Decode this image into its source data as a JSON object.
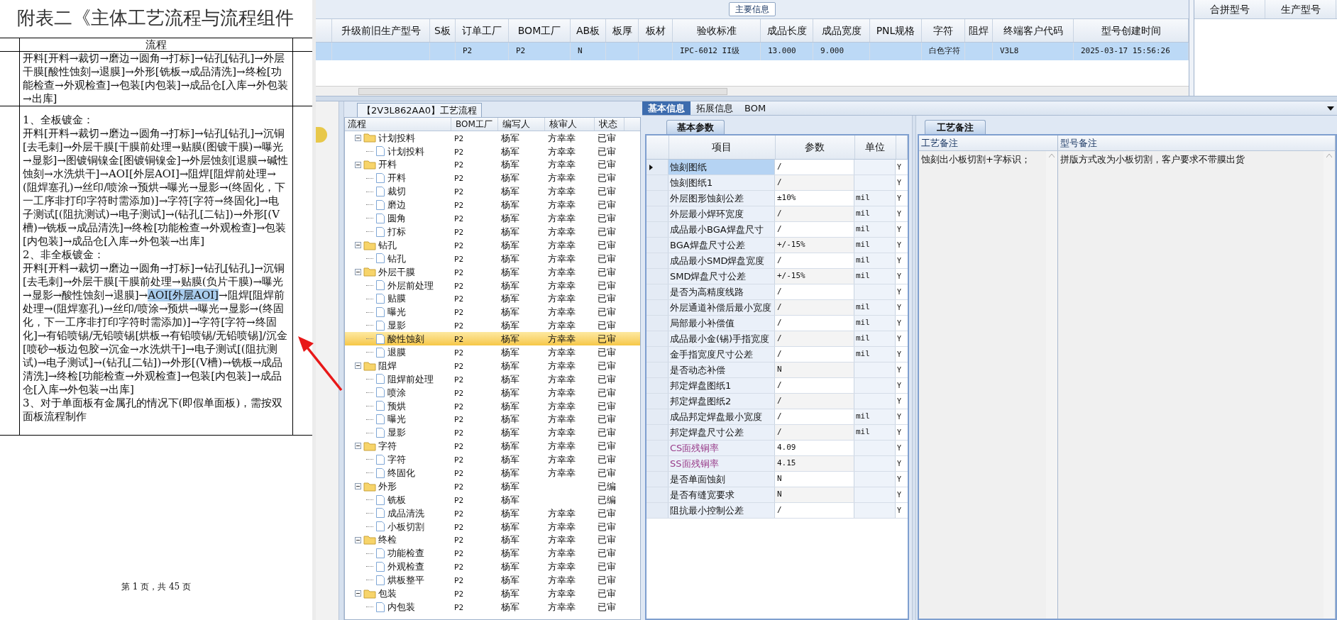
{
  "document": {
    "title": "附表二《主体工艺流程与流程组件",
    "header": "流程",
    "rows": [
      {
        "paragraphs": [
          {
            "text": "开料[开料→裁切→磨边→圆角→打标]→钻孔[钻孔]→外层干膜[酸性蚀刻→退膜]→外形[铣板→成品清洗]→终检[功能检查→外观检查]→包装[内包装]→成品仓[入库→外包装→出库]"
          }
        ]
      },
      {
        "paragraphs": [
          {
            "text": "1、全板镀金："
          },
          {
            "text": "开料[开料→裁切→磨边→圆角→打标]→钻孔[钻孔]→沉铜[去毛刺]→外层干膜[干膜前处理→贴膜(图镀干膜)→曝光→显影]→图镀铜镍金[图镀铜镍金]→外层蚀刻[退膜→碱性蚀刻→水洗烘干]→AOI[外层AOI]→阻焊[阻焊前处理→(阻焊塞孔)→丝印/喷涂→预烘→曝光→显影→(终固化，下一工序非打印字符时需添加)]→字符[字符→终固化]→电子测试[(阻抗测试)→电子测试]→(钻孔[二钻])→外形[(V槽)→铣板→成品清洗]→终检[功能检查→外观检查]→包装[内包装]→成品仓[入库→外包装→出库]"
          },
          {
            "text": "2、非全板镀金："
          },
          {
            "segments": [
              {
                "text": "开料[开料→裁切→磨边→圆角→打标]→钻孔[钻孔]→沉铜[去毛刺]→外层干膜[干膜前处理→贴膜(负片干膜)→曝光→显影→酸性蚀刻→退膜]→",
                "selected": false
              },
              {
                "text": "AOI[外层AOI]",
                "selected": true
              },
              {
                "text": "→阻焊[阻焊前处理→(阻焊塞孔)→丝印/喷涂→预烘→曝光→显影→(终固化，下一工序非打印字符时需添加)]→字符[字符→终固化]→有铅喷锡/无铅喷锡[烘板→有铅喷锡/无铅喷锡]/沉金[喷砂→板边包胶→沉金→水洗烘干]→电子测试[(阻抗测试)→电子测试]→(钻孔[二钻])→外形[(V槽)→铣板→成品清洗]→终检[功能检查→外观检查]→包装[内包装]→成品仓[入库→外包装→出库]",
                "selected": false
              }
            ]
          },
          {
            "text": "3、对于单面板有金属孔的情况下(即假单面板)，需按双面板流程制作"
          }
        ]
      }
    ],
    "footer": "第 1 页，共 45 页"
  },
  "main_info": {
    "title": "主要信息",
    "columns": [
      "升级前旧生产型号",
      "S板",
      "订单工厂",
      "BOM工厂",
      "AB板",
      "板厚",
      "板材",
      "验收标准",
      "成品长度",
      "成品宽度",
      "PNL规格",
      "字符",
      "阻焊",
      "终端客户代码",
      "型号创建时间"
    ],
    "rows": [
      {
        "selected": true,
        "cells": [
          null,
          null,
          "P2",
          "P2",
          "N",
          null,
          null,
          "IPC-6012 II级",
          "13.000",
          "9.000",
          null,
          "白色字符",
          null,
          "V3L8",
          "2025-03-17 15:56:26"
        ]
      }
    ]
  },
  "merge_panel": {
    "columns": [
      "合拼型号",
      "生产型号"
    ]
  },
  "process_panel": {
    "title": "【2V3L862AA0】工艺流程",
    "columns": [
      "流程",
      "BOM工厂",
      "编写人",
      "核审人",
      "状态"
    ],
    "steps": [
      {
        "name": "计划投料",
        "bom": "P2",
        "author": "杨军",
        "reviewer": "方幸幸",
        "status": "已审",
        "expanded": true,
        "selected": false,
        "children": [
          {
            "name": "计划投料",
            "bom": "P2",
            "author": "杨军",
            "reviewer": "方幸幸",
            "status": "已审",
            "selected": false
          }
        ]
      },
      {
        "name": "开料",
        "bom": "P2",
        "author": "杨军",
        "reviewer": "方幸幸",
        "status": "已审",
        "expanded": true,
        "selected": false,
        "children": [
          {
            "name": "开料",
            "bom": "P2",
            "author": "杨军",
            "reviewer": "方幸幸",
            "status": "已审",
            "selected": false
          },
          {
            "name": "裁切",
            "bom": "P2",
            "author": "杨军",
            "reviewer": "方幸幸",
            "status": "已审",
            "selected": false
          },
          {
            "name": "磨边",
            "bom": "P2",
            "author": "杨军",
            "reviewer": "方幸幸",
            "status": "已审",
            "selected": false
          },
          {
            "name": "圆角",
            "bom": "P2",
            "author": "杨军",
            "reviewer": "方幸幸",
            "status": "已审",
            "selected": false
          },
          {
            "name": "打标",
            "bom": "P2",
            "author": "杨军",
            "reviewer": "方幸幸",
            "status": "已审",
            "selected": false
          }
        ]
      },
      {
        "name": "钻孔",
        "bom": "P2",
        "author": "杨军",
        "reviewer": "方幸幸",
        "status": "已审",
        "expanded": true,
        "selected": false,
        "children": [
          {
            "name": "钻孔",
            "bom": "P2",
            "author": "杨军",
            "reviewer": "方幸幸",
            "status": "已审",
            "selected": false
          }
        ]
      },
      {
        "name": "外层干膜",
        "bom": "P2",
        "author": "杨军",
        "reviewer": "方幸幸",
        "status": "已审",
        "expanded": true,
        "selected": false,
        "children": [
          {
            "name": "外层前处理",
            "bom": "P2",
            "author": "杨军",
            "reviewer": "方幸幸",
            "status": "已审",
            "selected": false
          },
          {
            "name": "贴膜",
            "bom": "P2",
            "author": "杨军",
            "reviewer": "方幸幸",
            "status": "已审",
            "selected": false
          },
          {
            "name": "曝光",
            "bom": "P2",
            "author": "杨军",
            "reviewer": "方幸幸",
            "status": "已审",
            "selected": false
          },
          {
            "name": "显影",
            "bom": "P2",
            "author": "杨军",
            "reviewer": "方幸幸",
            "status": "已审",
            "selected": false
          },
          {
            "name": "酸性蚀刻",
            "bom": "P2",
            "author": "杨军",
            "reviewer": "方幸幸",
            "status": "已审",
            "selected": true
          },
          {
            "name": "退膜",
            "bom": "P2",
            "author": "杨军",
            "reviewer": "方幸幸",
            "status": "已审",
            "selected": false
          }
        ]
      },
      {
        "name": "阻焊",
        "bom": "P2",
        "author": "杨军",
        "reviewer": "方幸幸",
        "status": "已审",
        "expanded": true,
        "selected": false,
        "children": [
          {
            "name": "阻焊前处理",
            "bom": "P2",
            "author": "杨军",
            "reviewer": "方幸幸",
            "status": "已审",
            "selected": false
          },
          {
            "name": "喷涂",
            "bom": "P2",
            "author": "杨军",
            "reviewer": "方幸幸",
            "status": "已审",
            "selected": false
          },
          {
            "name": "预烘",
            "bom": "P2",
            "author": "杨军",
            "reviewer": "方幸幸",
            "status": "已审",
            "selected": false
          },
          {
            "name": "曝光",
            "bom": "P2",
            "author": "杨军",
            "reviewer": "方幸幸",
            "status": "已审",
            "selected": false
          },
          {
            "name": "显影",
            "bom": "P2",
            "author": "杨军",
            "reviewer": "方幸幸",
            "status": "已审",
            "selected": false
          }
        ]
      },
      {
        "name": "字符",
        "bom": "P2",
        "author": "杨军",
        "reviewer": "方幸幸",
        "status": "已审",
        "expanded": true,
        "selected": false,
        "children": [
          {
            "name": "字符",
            "bom": "P2",
            "author": "杨军",
            "reviewer": "方幸幸",
            "status": "已审",
            "selected": false
          },
          {
            "name": "终固化",
            "bom": "P2",
            "author": "杨军",
            "reviewer": "方幸幸",
            "status": "已审",
            "selected": false
          }
        ]
      },
      {
        "name": "外形",
        "bom": "P2",
        "author": "杨军",
        "status": "已编",
        "expanded": true,
        "selected": false,
        "children": [
          {
            "name": "铣板",
            "bom": "P2",
            "author": "杨军",
            "status": "已编",
            "selected": false
          },
          {
            "name": "成品清洗",
            "bom": "P2",
            "author": "杨军",
            "reviewer": "方幸幸",
            "status": "已审",
            "selected": false
          },
          {
            "name": "小板切割",
            "bom": "P2",
            "author": "杨军",
            "reviewer": "方幸幸",
            "status": "已审",
            "selected": false
          }
        ]
      },
      {
        "name": "终检",
        "bom": "P2",
        "author": "杨军",
        "reviewer": "方幸幸",
        "status": "已审",
        "expanded": true,
        "selected": false,
        "children": [
          {
            "name": "功能检查",
            "bom": "P2",
            "author": "杨军",
            "reviewer": "方幸幸",
            "status": "已审",
            "selected": false
          },
          {
            "name": "外观检查",
            "bom": "P2",
            "author": "杨军",
            "reviewer": "方幸幸",
            "status": "已审",
            "selected": false
          },
          {
            "name": "烘板整平",
            "bom": "P2",
            "author": "杨军",
            "reviewer": "方幸幸",
            "status": "已审",
            "selected": false
          }
        ]
      },
      {
        "name": "包装",
        "bom": "P2",
        "author": "杨军",
        "reviewer": "方幸幸",
        "status": "已审",
        "expanded": true,
        "selected": false,
        "children": [
          {
            "name": "内包装",
            "bom": "P2",
            "author": "杨军",
            "reviewer": "方幸幸",
            "status": "已审",
            "selected": false
          }
        ]
      }
    ]
  },
  "detail_tabs": [
    {
      "label": "基本信息",
      "selected": true
    },
    {
      "label": "拓展信息",
      "selected": false
    },
    {
      "label": "BOM",
      "selected": false
    }
  ],
  "params_panel": {
    "tab": "基本参数",
    "columns": [
      "项目",
      "参数",
      "单位"
    ],
    "rows": [
      {
        "item": "蚀刻图纸",
        "value": "/",
        "flag": "Y",
        "selected": true
      },
      {
        "item": "蚀刻图纸1",
        "value": "/",
        "flag": "Y",
        "selected": false
      },
      {
        "item": "外层图形蚀刻公差",
        "value": "±10%",
        "unit": "mil",
        "flag": "Y",
        "selected": false
      },
      {
        "item": "外层最小焊环宽度",
        "value": "/",
        "unit": "mil",
        "flag": "Y",
        "selected": false
      },
      {
        "item": "成品最小BGA焊盘尺寸",
        "value": "/",
        "unit": "mil",
        "flag": "Y",
        "selected": false
      },
      {
        "item": "BGA焊盘尺寸公差",
        "value": "+/-15%",
        "unit": "mil",
        "flag": "Y",
        "selected": false
      },
      {
        "item": "成品最小SMD焊盘宽度",
        "value": "/",
        "unit": "mil",
        "flag": "Y",
        "selected": false
      },
      {
        "item": "SMD焊盘尺寸公差",
        "value": "+/-15%",
        "unit": "mil",
        "flag": "Y",
        "selected": false
      },
      {
        "item": "是否为高精度线路",
        "value": "/",
        "flag": "Y",
        "selected": false
      },
      {
        "item": "外层通道补偿后最小宽度",
        "value": "/",
        "unit": "mil",
        "flag": "Y",
        "selected": false
      },
      {
        "item": "局部最小补偿值",
        "value": "/",
        "unit": "mil",
        "flag": "Y",
        "selected": false
      },
      {
        "item": "成品最小金(锡)手指宽度",
        "value": "/",
        "unit": "mil",
        "flag": "Y",
        "selected": false
      },
      {
        "item": "金手指宽度尺寸公差",
        "value": "/",
        "unit": "mil",
        "flag": "Y",
        "selected": false
      },
      {
        "item": "是否动态补偿",
        "value": "N",
        "flag": "Y",
        "selected": false
      },
      {
        "item": "邦定焊盘图纸1",
        "value": "/",
        "flag": "Y",
        "selected": false
      },
      {
        "item": "邦定焊盘图纸2",
        "value": "/",
        "flag": "Y",
        "selected": false
      },
      {
        "item": "成品邦定焊盘最小宽度",
        "value": "/",
        "unit": "mil",
        "flag": "Y",
        "selected": false
      },
      {
        "item": "邦定焊盘尺寸公差",
        "value": "/",
        "unit": "mil",
        "flag": "Y",
        "selected": false
      },
      {
        "item": "CS面残铜率",
        "value": "4.09",
        "flag": "Y",
        "selected": false,
        "color": "#993d8a"
      },
      {
        "item": "SS面残铜率",
        "value": "4.15",
        "flag": "Y",
        "selected": false,
        "color": "#993d8a"
      },
      {
        "item": "是否单面蚀刻",
        "value": "N",
        "flag": "Y",
        "selected": false
      },
      {
        "item": "是否有缝宽要求",
        "value": "N",
        "flag": "Y",
        "selected": false
      },
      {
        "item": "阻抗最小控制公差",
        "value": "/",
        "flag": "Y",
        "selected": false
      }
    ]
  },
  "notes_panel": {
    "tab": "工艺备注",
    "columns": [
      "工艺备注",
      "型号备注"
    ],
    "values": [
      "蚀刻出小板切割+字标识；",
      "拼版方式改为小板切割，客户要求不带膜出货"
    ]
  }
}
